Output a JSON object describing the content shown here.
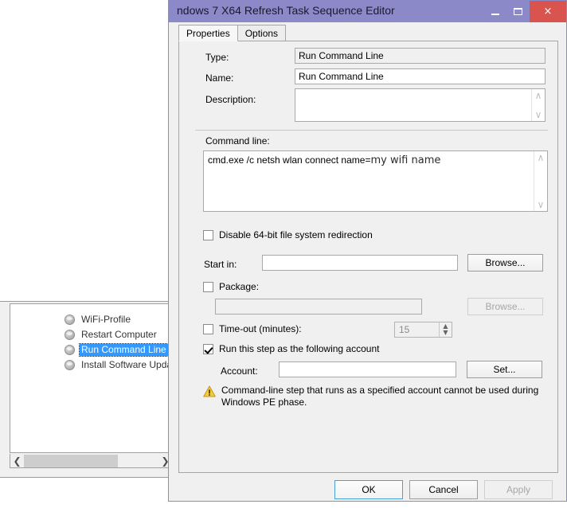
{
  "background_window": {
    "name": "task-sequence-list",
    "items": [
      {
        "label": "WiFi-Profile",
        "selected": false
      },
      {
        "label": "Restart Computer",
        "selected": false
      },
      {
        "label": "Run Command Line",
        "selected": true
      },
      {
        "label": "Install Software Updates",
        "selected": false
      }
    ],
    "scrollbar": {
      "left_arrow": "❮",
      "right_arrow": "❯"
    }
  },
  "dialog": {
    "title": "ndows 7 X64 Refresh Task Sequence Editor",
    "window_buttons": {
      "minimize": "minimize-icon",
      "maximize": "maximize-icon",
      "close": "×"
    },
    "tabs": [
      {
        "label": "Properties",
        "active": true
      },
      {
        "label": "Options",
        "active": false
      }
    ],
    "fields": {
      "type_label": "Type:",
      "type_value": "Run Command Line",
      "name_label": "Name:",
      "name_value": "Run Command Line",
      "description_label": "Description:",
      "description_value": "",
      "command_line_label": "Command line:",
      "command_line_value_main": "cmd.exe /c netsh wlan connect name=",
      "command_line_value_alt": "my wifi name",
      "disable_redirection_label": "Disable 64-bit file system redirection",
      "disable_redirection_checked": false,
      "start_in_label": "Start in:",
      "start_in_value": "",
      "start_in_browse_label": "Browse...",
      "package_label": "Package:",
      "package_checked": false,
      "package_value": "",
      "package_browse_label": "Browse...",
      "timeout_label": "Time-out (minutes):",
      "timeout_checked": false,
      "timeout_value": "15",
      "spinner_up": "▲",
      "spinner_down": "▼",
      "run_as_account_label": "Run this step as the following account",
      "run_as_account_checked": true,
      "account_label": "Account:",
      "account_value": "",
      "account_set_label": "Set...",
      "warning_text": "Command-line step that runs as a specified account cannot be used during Windows PE phase.",
      "warning_icon": "warning-triangle-icon"
    },
    "footer": {
      "ok_label": "OK",
      "cancel_label": "Cancel",
      "apply_label": "Apply",
      "apply_disabled": true
    },
    "scroll_arrows": {
      "up": "∧",
      "down": "∨"
    }
  },
  "colors": {
    "titlebar": "#8b89c8",
    "close_button": "#d9534f",
    "selection": "#3399ff",
    "warning": "#f0c419",
    "dialog_face": "#f0f0f0"
  }
}
